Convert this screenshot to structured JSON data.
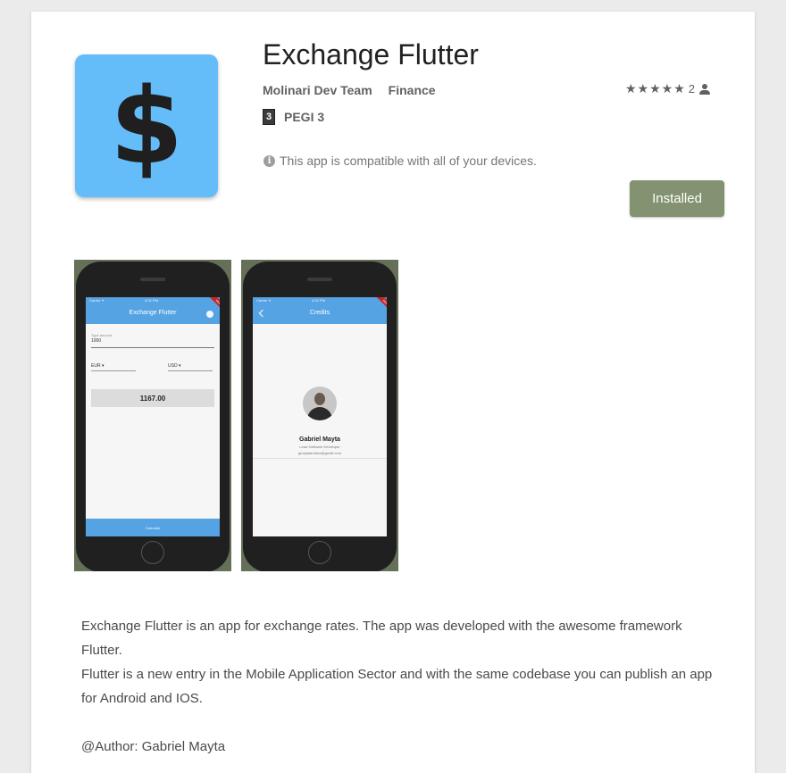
{
  "colors": {
    "icon_background": "#64bdf8",
    "icon_glyph": "#1f1f1f",
    "install_button": "#839271",
    "phone_appbar": "#56a3e3"
  },
  "app": {
    "icon_glyph": "$",
    "title": "Exchange Flutter",
    "developer": "Molinari Dev Team",
    "category": "Finance",
    "rating": {
      "stars": "★★★★★",
      "count": "2",
      "icon": "person-icon"
    },
    "content_rating": {
      "icon_digit": "3",
      "label": "PEGI 3"
    },
    "compatibility": {
      "icon": "info-icon",
      "text": "This app is compatible with all of your devices."
    },
    "install_label": "Installed"
  },
  "screenshots": [
    {
      "carrier": "Carrier ✦",
      "time": "4:02 PM",
      "title": "Exchange Flutter",
      "field_label": "Type amount",
      "field_value": "1000",
      "from_currency": "EUR ▾",
      "to_currency": "USD ▾",
      "result": "1167.00",
      "button_label": "Calculate",
      "debug_banner": "DEBUG"
    },
    {
      "carrier": "Carrier ✦",
      "time": "4:02 PM",
      "title": "Credits",
      "name": "Gabriel Mayta",
      "role": "Lead Software Developer",
      "email": "gmaytaandrea@gmail.com",
      "debug_banner": "DEBUG"
    }
  ],
  "description": {
    "line1": "Exchange Flutter is an app for exchange rates. The app was developed with the awesome framework Flutter.",
    "line2": "Flutter is a new entry in the Mobile Application Sector and with the same codebase you can publish an app for Android and IOS.",
    "author": "@Author: Gabriel Mayta"
  }
}
